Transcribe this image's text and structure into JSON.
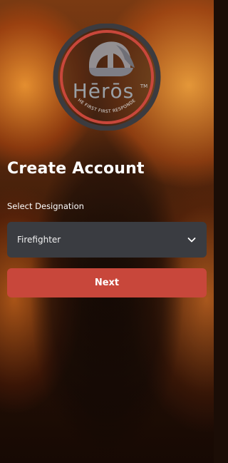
{
  "logo": {
    "brand_text": "Hērōs",
    "trademark": "TM",
    "tagline": "THE FIRST FIRST RESPONDER",
    "ring_color": "#c8473b"
  },
  "screen": {
    "title": "Create Account",
    "designation_label": "Select Designation",
    "designation_value": "Firefighter",
    "next_label": "Next"
  },
  "icons": {
    "dropdown": "chevron-down-icon"
  },
  "colors": {
    "accent": "#c8473b",
    "field_bg": "#3a3c41",
    "text": "#ffffff"
  }
}
